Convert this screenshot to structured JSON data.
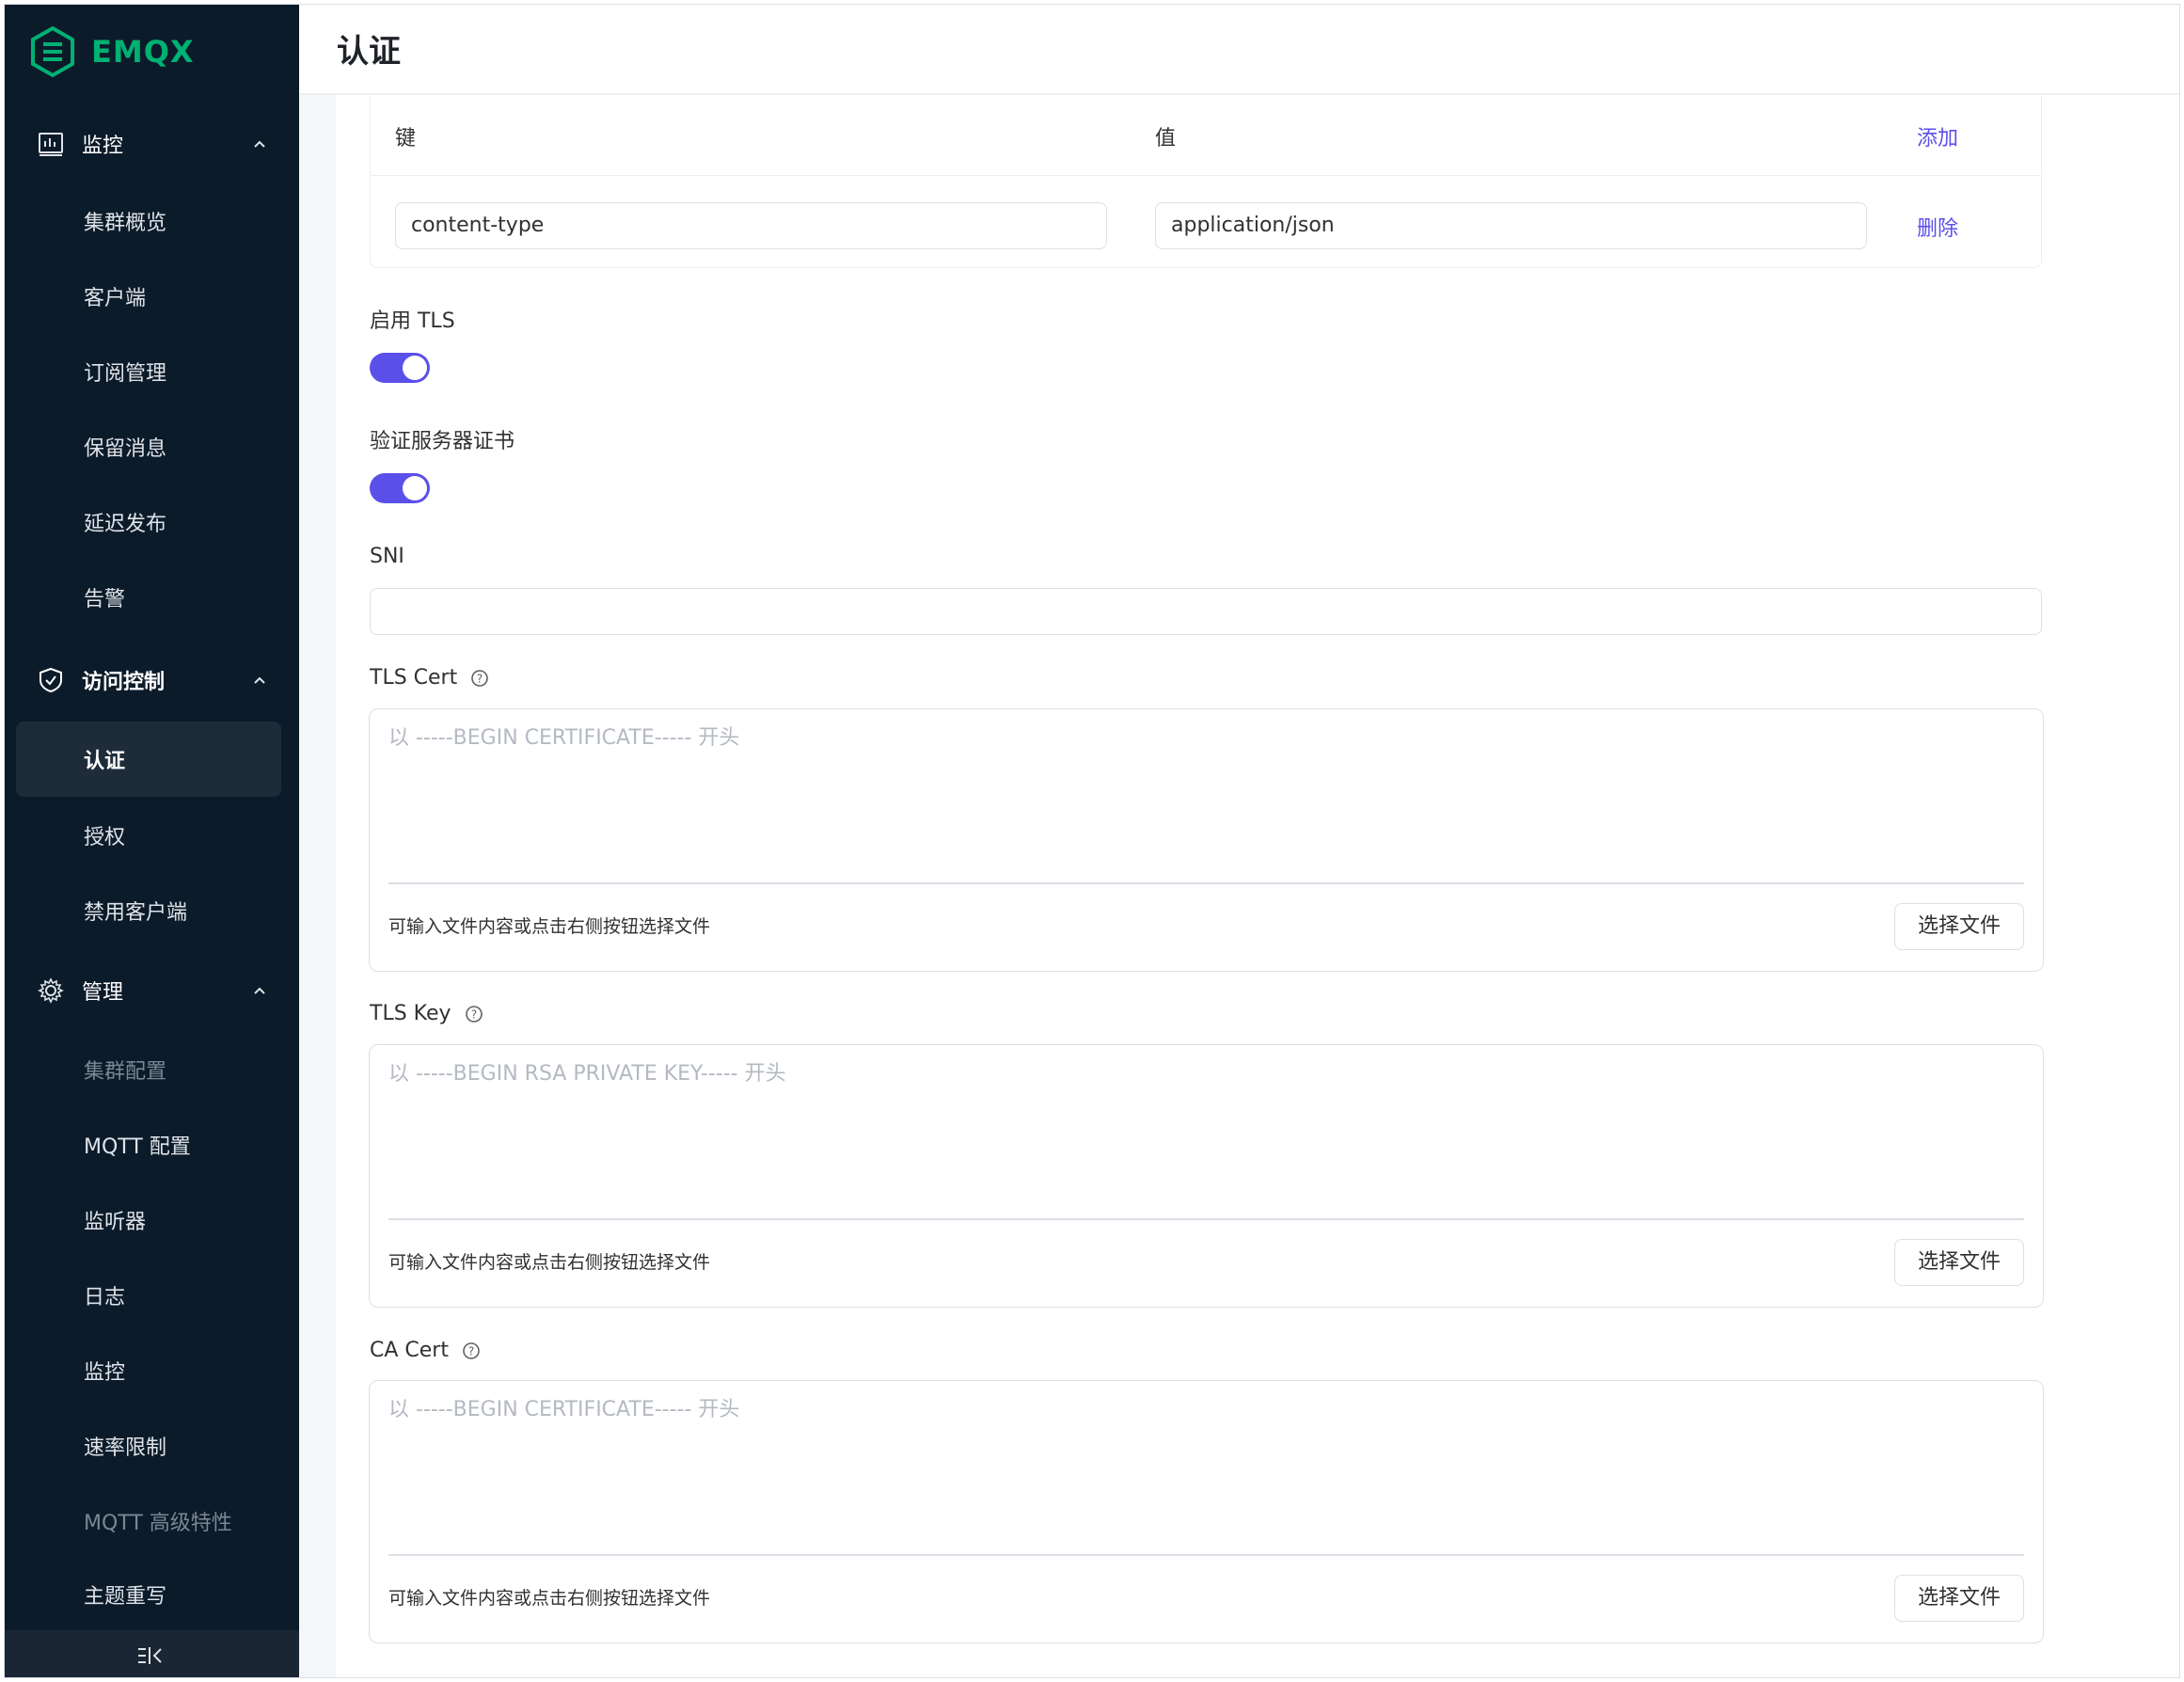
{
  "brand": {
    "name": "EMQX",
    "color": "#00b173"
  },
  "sidebar": {
    "groups": [
      {
        "label": "监控",
        "icon": "dashboard-chart-icon"
      },
      {
        "label": "访问控制",
        "icon": "shield-icon"
      },
      {
        "label": "管理",
        "icon": "gear-icon"
      }
    ],
    "monitor_items": [
      "集群概览",
      "客户端",
      "订阅管理",
      "保留消息",
      "延迟发布",
      "告警"
    ],
    "access_items": [
      "认证",
      "授权",
      "禁用客户端"
    ],
    "manage_items": [
      "集群配置",
      "MQTT 配置",
      "监听器",
      "日志",
      "监控",
      "速率限制",
      "MQTT 高级特性",
      "主题重写"
    ],
    "active_item": "认证"
  },
  "header": {
    "title": "认证"
  },
  "headers_table": {
    "key_header": "键",
    "value_header": "值",
    "add_label": "添加",
    "rows": [
      {
        "key": "content-type",
        "value": "application/json",
        "delete_label": "删除"
      }
    ]
  },
  "tls": {
    "enable_label": "启用 TLS",
    "enabled": true,
    "verify_label": "验证服务器证书",
    "verify": true,
    "sni_label": "SNI",
    "sni_value": ""
  },
  "certs": [
    {
      "label": "TLS Cert",
      "placeholder": "以 -----BEGIN CERTIFICATE----- 开头",
      "hint": "可输入文件内容或点击右侧按钮选择文件",
      "button": "选择文件"
    },
    {
      "label": "TLS Key",
      "placeholder": "以  -----BEGIN RSA PRIVATE KEY----- 开头",
      "hint": "可输入文件内容或点击右侧按钮选择文件",
      "button": "选择文件"
    },
    {
      "label": "CA Cert",
      "placeholder": "以 -----BEGIN CERTIFICATE----- 开头",
      "hint": "可输入文件内容或点击右侧按钮选择文件",
      "button": "选择文件"
    }
  ],
  "colors": {
    "accent": "#5b4fe9",
    "sidebar_bg": "#0c1b2a"
  }
}
